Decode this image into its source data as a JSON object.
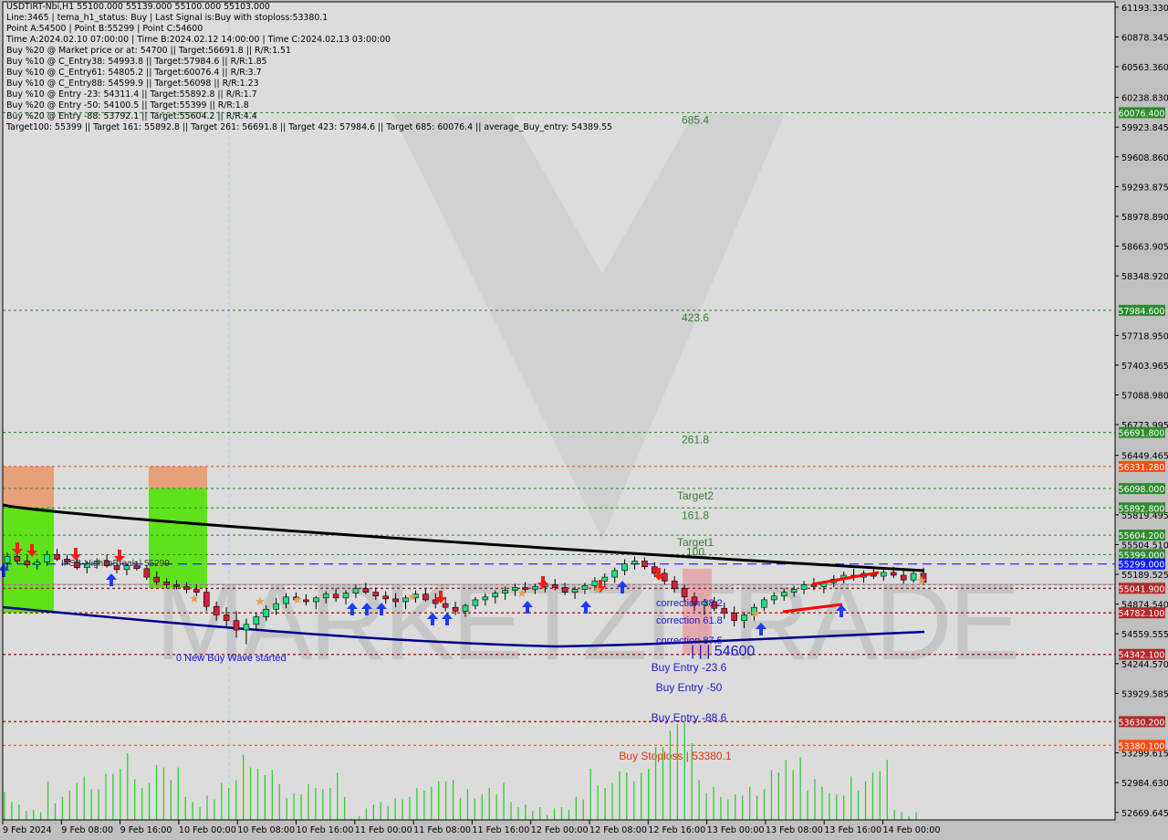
{
  "header": {
    "symbol_line": "USDTIRT-Nbi,H1  55100.000 55139.000 55100.000 55103.000",
    "info_lines": [
      "Line:3465 | tema_h1_status: Buy | Last Signal is:Buy with stoploss:53380.1",
      "Point A:54500 | Point B:55299 | Point C:54600",
      "Time A:2024.02.10 07:00:00 | Time B:2024.02.12 14:00:00 | Time C:2024.02.13 03:00:00",
      "Buy %20 @ Market price or at: 54700 || Target:56691.8 || R/R:1.51",
      "Buy %10 @ C_Entry38: 54993.8 || Target:57984.6 || R/R:1.85",
      "Buy %10 @ C_Entry61: 54805.2 || Target:60076.4 || R/R:3.7",
      "Buy %10 @ C_Entry88: 54599.9 || Target:56098 || R/R:1.23",
      "Buy %10 @ Entry -23: 54311.4 || Target:55892.8 || R/R:1.7",
      "Buy %20 @ Entry -50: 54100.5 || Target:55399 || R/R:1.8",
      "Buy %20 @ Entry -88: 53792.1 || Target:55604.2 || R/R:4.4",
      "Target100: 55399 || Target 161: 55892.8 || Target 261: 56691.8 || Target 423: 57984.6 || Target 685: 60076.4 || average_Buy_entry: 54389.55"
    ]
  },
  "watermark": "MARKETZITRADE",
  "colors": {
    "background": "#dcdcdc",
    "bull": "#22e07a",
    "bear": "#d0203a",
    "volume": "#33cc33",
    "target_line": "#228b22",
    "stop_line": "#ff4500",
    "entry_line": "#a52a2a",
    "blue_line": "#0000ff",
    "ma_slow": "#000000",
    "ma_fast": "#00008b"
  },
  "chart_data": {
    "type": "candlestick",
    "title": "USDTIRT-Nbi,H1",
    "ylim": [
      52550,
      61250
    ],
    "y_ticks": [
      "61193.330",
      "60878.345",
      "60563.360",
      "60238.830",
      "59923.845",
      "59608.860",
      "59293.875",
      "58978.890",
      "58663.905",
      "58348.920",
      "57718.950",
      "57403.965",
      "57088.980",
      "56773.995",
      "56449.465",
      "55819.495",
      "55504.510",
      "55189.525",
      "54874.540",
      "54559.555",
      "54244.570",
      "53929.585",
      "53299.615",
      "52984.630",
      "52669.645"
    ],
    "x_ticks": [
      "9 Feb 2024",
      "9 Feb 08:00",
      "9 Feb 16:00",
      "10 Feb 00:00",
      "10 Feb 08:00",
      "10 Feb 16:00",
      "11 Feb 00:00",
      "11 Feb 08:00",
      "11 Feb 16:00",
      "12 Feb 00:00",
      "12 Feb 08:00",
      "12 Feb 16:00",
      "13 Feb 00:00",
      "13 Feb 08:00",
      "13 Feb 16:00",
      "14 Feb 00:00"
    ],
    "price_levels": [
      {
        "price": 60076.4,
        "label": "60076.400",
        "kind": "target",
        "text": "685.4"
      },
      {
        "price": 57984.6,
        "label": "57984.600",
        "kind": "target",
        "text": "423.6"
      },
      {
        "price": 56691.8,
        "label": "56691.800",
        "kind": "target",
        "text": "261.8"
      },
      {
        "price": 56331.28,
        "label": "56331.280",
        "kind": "stop",
        "text": ""
      },
      {
        "price": 56098.0,
        "label": "56098.000",
        "kind": "target",
        "text": "Target2"
      },
      {
        "price": 55892.8,
        "label": "55892.800",
        "kind": "target",
        "text": "161.8"
      },
      {
        "price": 55604.2,
        "label": "55604.200",
        "kind": "target",
        "text": "Target1"
      },
      {
        "price": 55399.0,
        "label": "55399.000",
        "kind": "target",
        "text": "100"
      },
      {
        "price": 55299.0,
        "label": "55299.000",
        "kind": "blue",
        "text": ""
      },
      {
        "price": 55041.9,
        "label": "55041.900",
        "kind": "entry",
        "text": ""
      },
      {
        "price": 54782.1,
        "label": "54782.100",
        "kind": "entry",
        "text": ""
      },
      {
        "price": 54342.1,
        "label": "54342.100",
        "kind": "entry",
        "text": ""
      },
      {
        "price": 53630.2,
        "label": "53630.200",
        "kind": "entry",
        "text": ""
      },
      {
        "price": 53380.1,
        "label": "53380.100",
        "kind": "stop",
        "text": ""
      }
    ],
    "current_price": {
      "price": 55103.0,
      "label": "55103.000"
    },
    "annotations": [
      {
        "text": "IFSB-HighToBreak | 55299",
        "kind": "label"
      },
      {
        "text": "0 New Buy Wave started",
        "kind": "blue-text"
      },
      {
        "text": "correction 38.2",
        "kind": "blue-text"
      },
      {
        "text": "correction 61.8",
        "kind": "blue-text"
      },
      {
        "text": "correction 87.5",
        "kind": "blue-text"
      },
      {
        "text": "| | | 54600",
        "kind": "blue-text-large"
      },
      {
        "text": "Buy Entry -23.6",
        "kind": "blue-text"
      },
      {
        "text": "Buy Entry -50",
        "kind": "blue-text"
      },
      {
        "text": "Buy Entry -88.6",
        "kind": "blue-text"
      },
      {
        "text": "Buy Stoploss | 53380.1",
        "kind": "red-text"
      }
    ],
    "candles": [
      [
        55310,
        55420,
        55240,
        55380
      ],
      [
        55380,
        55460,
        55300,
        55330
      ],
      [
        55330,
        55400,
        55260,
        55290
      ],
      [
        55290,
        55350,
        55240,
        55320
      ],
      [
        55320,
        55440,
        55280,
        55400
      ],
      [
        55400,
        55460,
        55330,
        55350
      ],
      [
        55350,
        55400,
        55290,
        55320
      ],
      [
        55320,
        55380,
        55240,
        55260
      ],
      [
        55260,
        55330,
        55200,
        55300
      ],
      [
        55300,
        55360,
        55250,
        55330
      ],
      [
        55330,
        55400,
        55260,
        55280
      ],
      [
        55280,
        55310,
        55200,
        55240
      ],
      [
        55240,
        55300,
        55180,
        55280
      ],
      [
        55280,
        55330,
        55230,
        55250
      ],
      [
        55250,
        55290,
        55130,
        55160
      ],
      [
        55160,
        55220,
        55080,
        55110
      ],
      [
        55110,
        55150,
        55040,
        55080
      ],
      [
        55080,
        55130,
        55030,
        55060
      ],
      [
        55060,
        55110,
        54990,
        55030
      ],
      [
        55030,
        55080,
        54960,
        55000
      ],
      [
        55000,
        55040,
        54800,
        54850
      ],
      [
        54850,
        54900,
        54700,
        54760
      ],
      [
        54760,
        54840,
        54640,
        54700
      ],
      [
        54700,
        54800,
        54520,
        54600
      ],
      [
        54600,
        54720,
        54450,
        54660
      ],
      [
        54660,
        54780,
        54600,
        54740
      ],
      [
        54740,
        54860,
        54700,
        54820
      ],
      [
        54820,
        54940,
        54760,
        54880
      ],
      [
        54880,
        54990,
        54830,
        54950
      ],
      [
        54950,
        55000,
        54890,
        54920
      ],
      [
        54920,
        54980,
        54860,
        54900
      ],
      [
        54900,
        54960,
        54820,
        54940
      ],
      [
        54940,
        55010,
        54880,
        54980
      ],
      [
        54980,
        55040,
        54900,
        54940
      ],
      [
        54940,
        55020,
        54870,
        54990
      ],
      [
        54990,
        55080,
        54940,
        55040
      ],
      [
        55040,
        55100,
        54980,
        55000
      ],
      [
        55000,
        55050,
        54920,
        54960
      ],
      [
        54960,
        55010,
        54880,
        54930
      ],
      [
        54930,
        54990,
        54840,
        54900
      ],
      [
        54900,
        54970,
        54820,
        54940
      ],
      [
        54940,
        55020,
        54890,
        54980
      ],
      [
        54980,
        55040,
        54900,
        54920
      ],
      [
        54920,
        54990,
        54830,
        54880
      ],
      [
        54880,
        54950,
        54800,
        54840
      ],
      [
        54840,
        54900,
        54760,
        54800
      ],
      [
        54800,
        54880,
        54740,
        54860
      ],
      [
        54860,
        54950,
        54820,
        54920
      ],
      [
        54920,
        54990,
        54860,
        54950
      ],
      [
        54950,
        55020,
        54880,
        54990
      ],
      [
        54990,
        55060,
        54920,
        55020
      ],
      [
        55020,
        55090,
        54960,
        55050
      ],
      [
        55050,
        55110,
        54990,
        55030
      ],
      [
        55030,
        55090,
        54980,
        55060
      ],
      [
        55060,
        55120,
        55000,
        55080
      ],
      [
        55080,
        55140,
        55020,
        55050
      ],
      [
        55050,
        55100,
        54970,
        55000
      ],
      [
        55000,
        55060,
        54930,
        55030
      ],
      [
        55030,
        55100,
        54980,
        55070
      ],
      [
        55070,
        55160,
        55020,
        55120
      ],
      [
        55120,
        55200,
        55060,
        55160
      ],
      [
        55160,
        55260,
        55100,
        55230
      ],
      [
        55230,
        55350,
        55180,
        55300
      ],
      [
        55300,
        55380,
        55240,
        55330
      ],
      [
        55330,
        55370,
        55240,
        55270
      ],
      [
        55270,
        55320,
        55160,
        55200
      ],
      [
        55200,
        55250,
        55080,
        55120
      ],
      [
        55120,
        55170,
        55000,
        55040
      ],
      [
        55040,
        55080,
        54900,
        54950
      ],
      [
        54950,
        55000,
        54800,
        54870
      ],
      [
        54870,
        54930,
        54760,
        54900
      ],
      [
        54900,
        54950,
        54800,
        54830
      ],
      [
        54830,
        54890,
        54720,
        54780
      ],
      [
        54780,
        54850,
        54640,
        54700
      ],
      [
        54700,
        54790,
        54620,
        54760
      ],
      [
        54760,
        54880,
        54700,
        54840
      ],
      [
        54840,
        54950,
        54800,
        54920
      ],
      [
        54920,
        55000,
        54870,
        54960
      ],
      [
        54960,
        55040,
        54910,
        55000
      ],
      [
        55000,
        55070,
        54950,
        55030
      ],
      [
        55030,
        55120,
        54980,
        55080
      ],
      [
        55080,
        55150,
        55020,
        55060
      ],
      [
        55060,
        55120,
        54990,
        55100
      ],
      [
        55100,
        55180,
        55050,
        55140
      ],
      [
        55140,
        55220,
        55090,
        55180
      ],
      [
        55180,
        55250,
        55120,
        55160
      ],
      [
        55160,
        55230,
        55100,
        55200
      ],
      [
        55200,
        55260,
        55140,
        55170
      ],
      [
        55170,
        55240,
        55120,
        55210
      ],
      [
        55210,
        55270,
        55150,
        55180
      ],
      [
        55180,
        55230,
        55090,
        55130
      ],
      [
        55130,
        55220,
        55100,
        55200
      ],
      [
        55200,
        55260,
        55080,
        55103
      ]
    ],
    "volumes": [
      22,
      14,
      12,
      7,
      8,
      6,
      30,
      13,
      18,
      23,
      29,
      34,
      24,
      24,
      36,
      36,
      40,
      52,
      32,
      25,
      29,
      43,
      41,
      31,
      41,
      18,
      14,
      10,
      19,
      16,
      29,
      25,
      31,
      51,
      41,
      40,
      35,
      39,
      28,
      17,
      21,
      20,
      28,
      25,
      24,
      25,
      37,
      18,
      1,
      3,
      9,
      12,
      14,
      11,
      17,
      16,
      18,
      25,
      23,
      26,
      30,
      30,
      31,
      17,
      24,
      17,
      20,
      25,
      20,
      29,
      14,
      10,
      12,
      7,
      10,
      4,
      9,
      10,
      8,
      18,
      16,
      40,
      27,
      25,
      29,
      38,
      37,
      30,
      37,
      40,
      57,
      57,
      70,
      75,
      76,
      60,
      31,
      21,
      26,
      18,
      16,
      20,
      19,
      26,
      19,
      24,
      39,
      37,
      47,
      39,
      49,
      23,
      32,
      26,
      21,
      20,
      19,
      34,
      23,
      30,
      37,
      38,
      47,
      8,
      6,
      3,
      6
    ]
  }
}
